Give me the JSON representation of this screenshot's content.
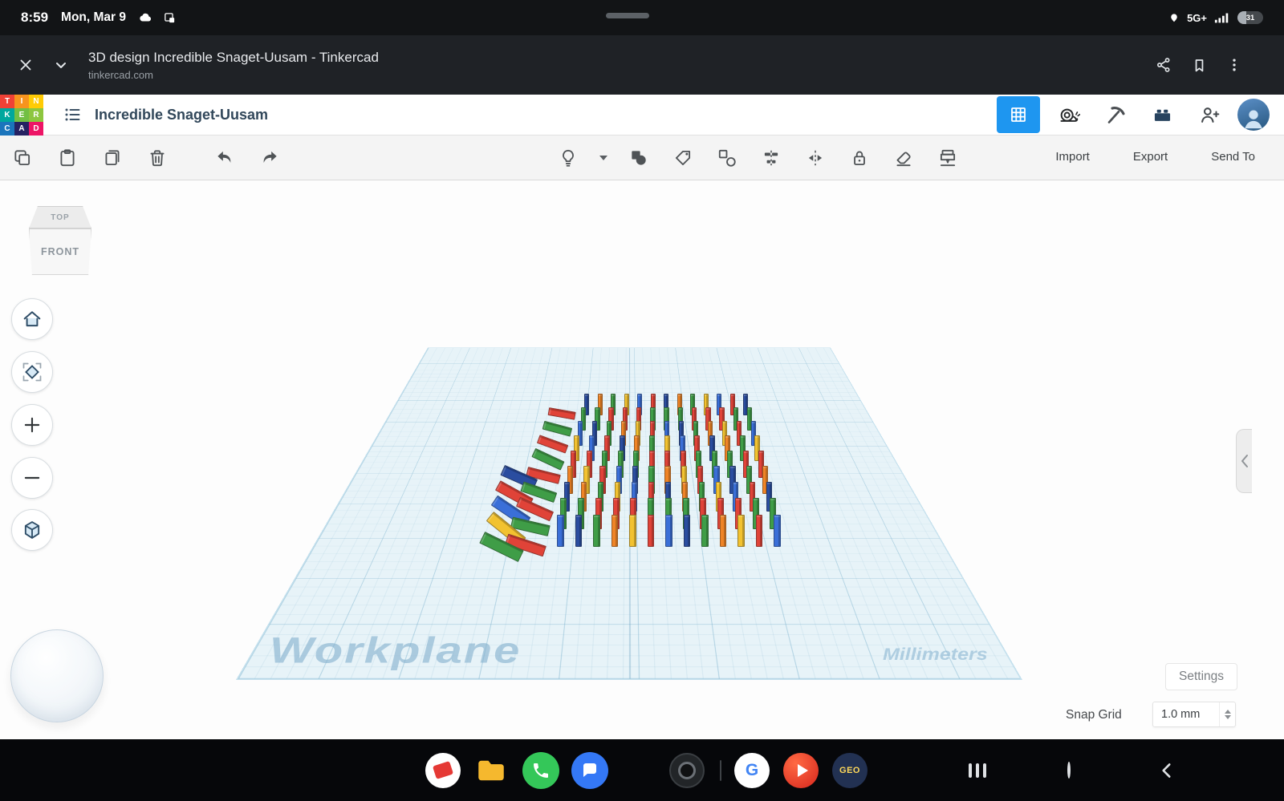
{
  "status_bar": {
    "time": "8:59",
    "date": "Mon, Mar 9",
    "network": "5G+",
    "battery_percent": "31"
  },
  "browser": {
    "title": "3D design Incredible Snaget-Uusam - Tinkercad",
    "url": "tinkercad.com"
  },
  "header": {
    "design_name": "Incredible Snaget-Uusam"
  },
  "logo": {
    "cells": [
      {
        "ch": "T",
        "bg": "#ef4136"
      },
      {
        "ch": "I",
        "bg": "#f7941e"
      },
      {
        "ch": "N",
        "bg": "#ffcb05"
      },
      {
        "ch": "K",
        "bg": "#00a79d"
      },
      {
        "ch": "E",
        "bg": "#72bf44"
      },
      {
        "ch": "R",
        "bg": "#8dc63f"
      },
      {
        "ch": "C",
        "bg": "#1b75bc"
      },
      {
        "ch": "A",
        "bg": "#262262"
      },
      {
        "ch": "D",
        "bg": "#ed1566"
      }
    ]
  },
  "toolbar": {
    "import_label": "Import",
    "export_label": "Export",
    "send_to_label": "Send To"
  },
  "viewcube": {
    "top_label": "TOP",
    "front_label": "FRONT"
  },
  "viewport": {
    "workplane_label": "Workplane",
    "units_label": "Millimeters"
  },
  "footer": {
    "settings_label": "Settings",
    "snap_grid_label": "Snap Grid",
    "snap_grid_value": "1.0 mm"
  },
  "dock": {
    "google_letter": "G",
    "geo_label": "GEO"
  },
  "scene": {
    "type": "domino-grid",
    "rows": 9,
    "cols": 14,
    "palette": [
      "#e04338",
      "#3a6fd8",
      "#f2c230",
      "#3f9d47",
      "#ef8426",
      "#2a4da0"
    ]
  },
  "colors": {
    "accent_blue": "#1e96f0",
    "workplane_fill": "#e7f3f8"
  }
}
